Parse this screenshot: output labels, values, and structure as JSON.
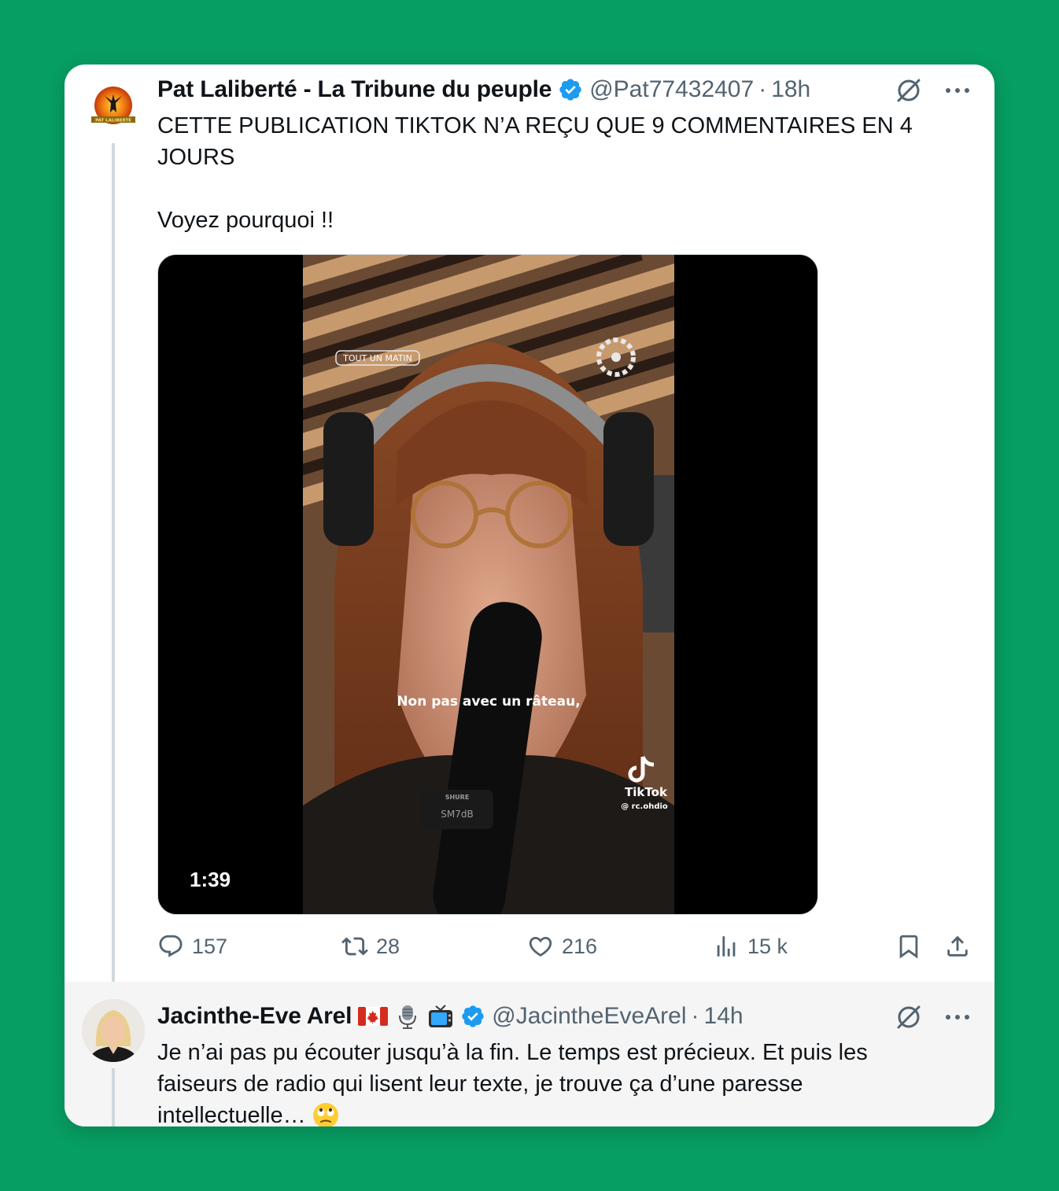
{
  "tweet": {
    "author_name": "Pat Laliberté - La Tribune du peuple",
    "handle": "@Pat77432407",
    "separator": "·",
    "time": "18h",
    "avatar_text": "PAT LALIBERTÉ",
    "text_line1": "CETTE PUBLICATION TIKTOK N’A REÇU QUE 9 COMMENTAIRES EN 4",
    "text_line2": "JOURS",
    "text_line3": "Voyez pourquoi !!",
    "video": {
      "duration": "1:39",
      "badge": "TOUT UN MATIN",
      "caption": "Non pas avec un râteau,",
      "tiktok_label": "TikTok",
      "tiktok_handle": "@ rc.ohdio",
      "mic_brand": "SHURE",
      "mic_model": "SM7dB"
    },
    "actions": {
      "replies": "157",
      "reposts": "28",
      "likes": "216",
      "views": "15 k"
    }
  },
  "reply": {
    "author_name": "Jacinthe-Eve Arel",
    "handle": "@JacintheEveArel",
    "separator": "·",
    "time": "14h",
    "text_line1": "Je n’ai pas pu écouter jusqu’à la fin. Le temps est précieux. Et puis les",
    "text_line2": "faiseurs de radio qui lisent leur texte, je trouve ça d’une paresse",
    "text_line3": "intellectuelle…"
  },
  "colors": {
    "background": "#079e62",
    "verified": "#1d9bf0",
    "secondary_text": "#536471"
  }
}
